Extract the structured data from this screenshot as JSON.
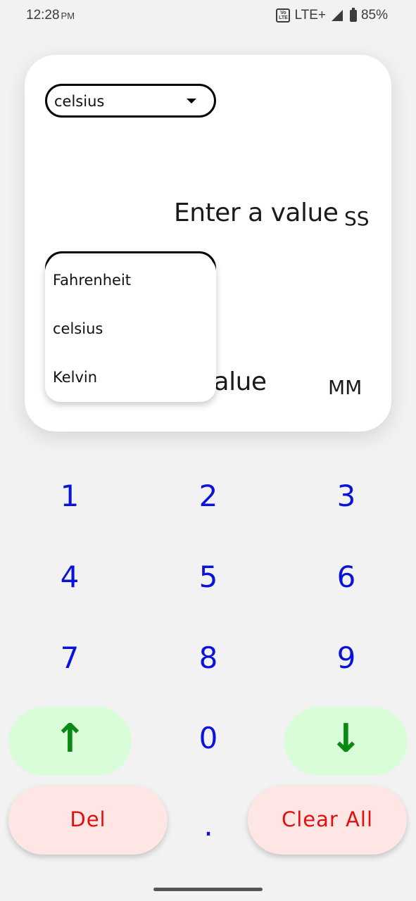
{
  "status_bar": {
    "time": "12:28",
    "ampm": "PM",
    "volte": "Vo LTE",
    "network": "LTE+",
    "battery": "85%"
  },
  "converter": {
    "from_unit": "celsius",
    "to_unit": "",
    "input_placeholder": "Enter a value",
    "input_unit": "SS",
    "output_placeholder": "Enter a value",
    "output_visible": "r a value",
    "output_unit": "MM"
  },
  "dropdown": {
    "options": [
      "Fahrenheit",
      "celsius",
      "Kelvin"
    ]
  },
  "keypad": {
    "keys": [
      "1",
      "2",
      "3",
      "4",
      "5",
      "6",
      "7",
      "8",
      "9",
      "0",
      "."
    ],
    "up": "↑",
    "down": "↓",
    "delete_label": "Del",
    "clear_label": "Clear All"
  },
  "colors": {
    "key_text": "#0a14d8",
    "arrow_bg": "#d9fcd9",
    "arrow_text": "#0a8a14",
    "action_bg": "#fde6e4",
    "action_text": "#e01010"
  }
}
